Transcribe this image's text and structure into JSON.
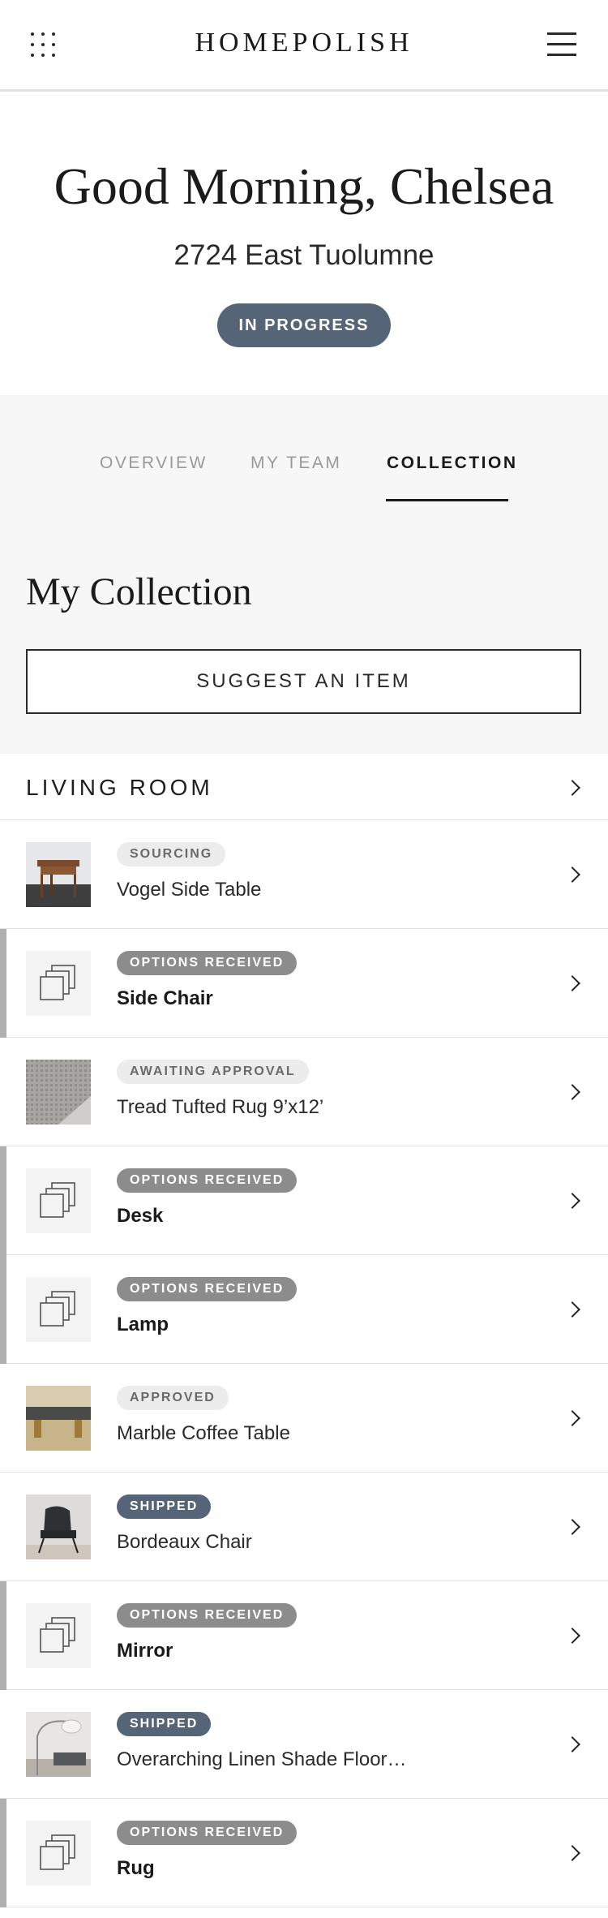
{
  "header": {
    "brand": "HOMEPOLISH",
    "grid_icon": "grid-dots-icon",
    "menu_icon": "hamburger-menu-icon"
  },
  "hero": {
    "greeting": "Good Morning, Chelsea",
    "address": "2724 East Tuolumne",
    "status": "IN PROGRESS"
  },
  "tabs": [
    {
      "label": "OVERVIEW",
      "active": false
    },
    {
      "label": "MY TEAM",
      "active": false
    },
    {
      "label": "COLLECTION",
      "active": true
    }
  ],
  "collection": {
    "title": "My Collection",
    "suggest_label": "SUGGEST AN ITEM"
  },
  "room": {
    "label": "LIVING ROOM"
  },
  "items": [
    {
      "status": "SOURCING",
      "name": "Vogel Side Table",
      "thumb": "side-table-photo",
      "style": "light",
      "highlight": false
    },
    {
      "status": "OPTIONS RECEIVED",
      "name": "Side Chair",
      "thumb": "placeholder-stack-icon",
      "style": "dark",
      "highlight": true
    },
    {
      "status": "AWAITING APPROVAL",
      "name": "Tread Tufted Rug 9’x12’",
      "thumb": "rug-photo",
      "style": "light",
      "highlight": false
    },
    {
      "status": "OPTIONS RECEIVED",
      "name": "Desk",
      "thumb": "placeholder-stack-icon",
      "style": "dark",
      "highlight": true
    },
    {
      "status": "OPTIONS RECEIVED",
      "name": "Lamp",
      "thumb": "placeholder-stack-icon",
      "style": "dark",
      "highlight": true
    },
    {
      "status": "APPROVED",
      "name": "Marble Coffee Table",
      "thumb": "coffee-table-photo",
      "style": "light",
      "highlight": false
    },
    {
      "status": "SHIPPED",
      "name": "Bordeaux Chair",
      "thumb": "chair-photo",
      "style": "slate",
      "highlight": false
    },
    {
      "status": "OPTIONS RECEIVED",
      "name": "Mirror",
      "thumb": "placeholder-stack-icon",
      "style": "dark",
      "highlight": true
    },
    {
      "status": "SHIPPED",
      "name": "Overarching Linen Shade Floor…",
      "thumb": "floor-lamp-photo",
      "style": "slate",
      "highlight": false
    },
    {
      "status": "OPTIONS RECEIVED",
      "name": "Rug",
      "thumb": "placeholder-stack-icon",
      "style": "dark",
      "highlight": true
    }
  ]
}
